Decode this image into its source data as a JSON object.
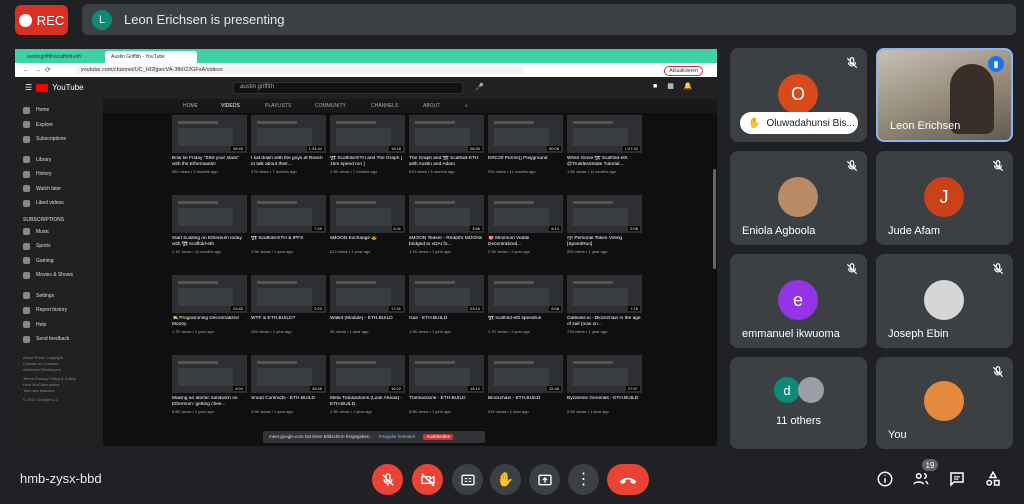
{
  "meeting": {
    "rec_label": "REC",
    "presenter_initial": "L",
    "presenting_text": "Leon Erichsen is presenting",
    "code": "hmb-zysx-bbd",
    "participant_count": "19"
  },
  "browser": {
    "tabs": [
      "austingriffith/scaffold-eth",
      "Austin Griffith - YouTube"
    ],
    "url": "youtube.com/channel/UC_HI2ljpecVA-3fb022GFsA/videos",
    "update_label": "Aktualisieren"
  },
  "youtube": {
    "search_value": "austin griffith",
    "tabs": [
      "HOME",
      "VIDEOS",
      "PLAYLISTS",
      "COMMUNITY",
      "CHANNELS",
      "ABOUT"
    ],
    "sidebar": [
      "Home",
      "Explore",
      "Subscriptions",
      "Library",
      "History",
      "Watch later",
      "Liked videos"
    ],
    "subscriptions_heading": "SUBSCRIPTIONS",
    "subscriptions": [
      "Music",
      "Sports",
      "Gaming",
      "Movies & Shows"
    ],
    "bottom_items": [
      "Settings",
      "Report history",
      "Help",
      "Send feedback"
    ],
    "footer": [
      "About  Press  Copyright",
      "Contact us  Creators",
      "Advertise  Developers",
      "Terms  Privacy  Policy & Safety",
      "How YouTube works",
      "Test new features",
      "© 2021 Google LLC"
    ],
    "videos": [
      {
        "title": "Bow tie Friday \"Shill your stack\" with the Ethernauts!!",
        "meta": "582 views • 3 months ago",
        "dur": "49:45"
      },
      {
        "title": "I sat down with the guys at Reach to talk about their...",
        "meta": "375 views • 7 months ago",
        "dur": "1:24:34"
      },
      {
        "title": "🏗 Scaffold-ETH and The Graph [ 15m speed run ]",
        "meta": "1.9K views • 7 months ago",
        "dur": "15:18"
      },
      {
        "title": "The Graph and 🏗 Scaffold-ETH with Austin and Adam",
        "meta": "510 views • 8 months ago",
        "dur": "26:30"
      },
      {
        "title": "ERC20 Permit() Playground",
        "meta": "934 views • 11 months ago",
        "dur": "50:09"
      },
      {
        "title": "White Glove 🏗 Scaffold-eth @TrustlessState Tutorial...",
        "meta": "1.8K views • 11 months ago",
        "dur": "1:27:34"
      },
      {
        "title": "Start building on Ethereum today with 🏗 scaffold-eth",
        "meta": "2.1K views • 11 months ago",
        "dur": ""
      },
      {
        "title": "🏗 Scaffold-ETH & IPFS",
        "meta": "1.5K views • 1 year ago",
        "dur": "7:29"
      },
      {
        "title": "sMOON Exchange 😎",
        "meta": "612 views • 1 year ago",
        "dur": "6:11"
      },
      {
        "title": "sMOON Teaser - Reddit's MOONs bridged to xDAI fo...",
        "meta": "1.1K views • 1 year ago",
        "dur": "3:56"
      },
      {
        "title": "🎯 Minimum Viable Decentralized...",
        "meta": "2.9K views • 1 year ago",
        "dur": "6:14"
      },
      {
        "title": "🗳 Personal Token Voting [SpeedRun]",
        "meta": "593 views • 1 year ago",
        "dur": "2:06"
      },
      {
        "title": "💸 Programming Decentralized Money",
        "meta": "1.7K views • 1 year ago",
        "dur": "23:43"
      },
      {
        "title": "WTF is ETH.BUILD?",
        "meta": "28K views • 1 year ago",
        "dur": "2:23"
      },
      {
        "title": "Wallet (Module) - ETH.BUILD",
        "meta": "2K views • 1 year ago",
        "dur": "17:31"
      },
      {
        "title": "Gas - ETH.BUILD",
        "meta": "1.5K views • 1 year ago",
        "dur": "23:14"
      },
      {
        "title": "🏗 scaffold-eth speedrun",
        "meta": "1.7K views • 1 year ago",
        "dur": "6:08"
      },
      {
        "title": "Galleass.io - Blockchain in the age of sail (now on...",
        "meta": "739 views • 1 year ago",
        "dur": "7:16"
      },
      {
        "title": "Making an atomic sandwich on Ethereum: getting chee...",
        "meta": "5.6K views • 1 year ago",
        "dur": "6:04"
      },
      {
        "title": "Smart Contracts - ETH.BUILD",
        "meta": "4.9K views • 1 year ago",
        "dur": "26:45"
      },
      {
        "title": "Meta Transactions (Look Ahead) - ETH.BUILD",
        "meta": "2.9K views • 1 year ago",
        "dur": "10:22"
      },
      {
        "title": "Transactions - ETH.BUILD",
        "meta": "8.8K views • 1 year ago",
        "dur": "15:12"
      },
      {
        "title": "Blockchain - ETH.BUILD",
        "meta": "51K views • 1 year ago",
        "dur": "22:45"
      },
      {
        "title": "Byzantine Generals - ETH.BUILD",
        "meta": "5.5K views • 1 year ago",
        "dur": "27:57"
      }
    ],
    "toast": {
      "text": "meet.google.com hat Ihren Bildschirm freigegeben.",
      "hide": "Freigabe beenden",
      "stop": "Ausblenden"
    }
  },
  "participants": [
    {
      "name": "Oluwadahunsi Bis...",
      "initial": "O",
      "color": "#d84a1b"
    },
    {
      "name": "Leon Erichsen"
    },
    {
      "name": "Eniola Agboola"
    },
    {
      "name": "Jude Afam",
      "initial": "J",
      "color": "#c9421a"
    },
    {
      "name": "emmanuel ikwuoma",
      "initial": "e",
      "color": "#9334e6"
    },
    {
      "name": "Joseph Ebin"
    },
    {
      "name": "11 others",
      "initial": "d",
      "color": "#0e8a78"
    },
    {
      "name": "You"
    }
  ],
  "icons": {
    "mic_off": "mic-off-icon",
    "cam_off": "videocam-off-icon",
    "captions": "captions-icon",
    "hand": "raise-hand-icon",
    "present": "present-icon",
    "more": "more-vert-icon",
    "end": "call-end-icon",
    "info": "info-icon",
    "people": "people-icon",
    "chat": "chat-icon",
    "activities": "activities-icon"
  },
  "colors": {
    "rec": "#d93025",
    "end": "#ea4335",
    "tile": "#3c4043",
    "bg": "#202124"
  }
}
